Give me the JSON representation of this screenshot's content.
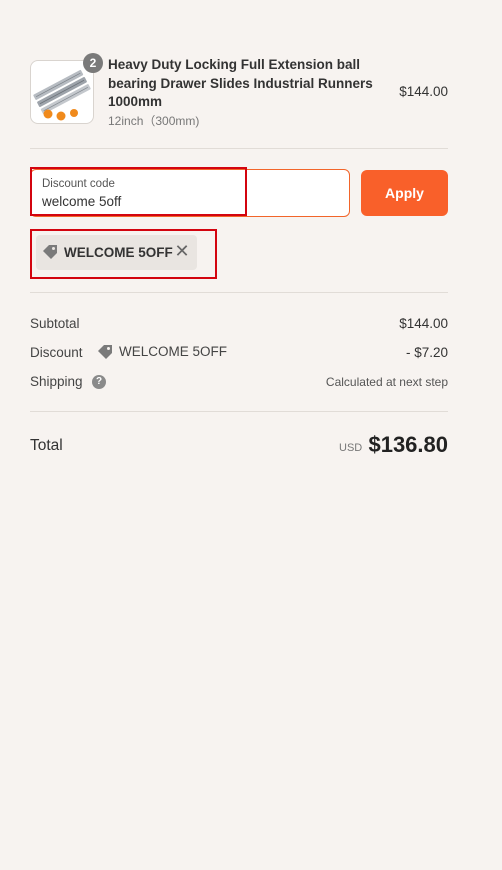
{
  "product": {
    "quantity": "2",
    "title": "Heavy Duty Locking Full Extension ball bearing Drawer Slides Industrial Runners 1000mm",
    "variant": "12inch（300mm)",
    "price": "$144.00",
    "image_icon": "drawer-slides-image"
  },
  "discount": {
    "label": "Discount code",
    "value": "welcome 5off",
    "apply_label": "Apply",
    "applied_code": "WELCOME 5OFF",
    "remove_icon": "close-icon"
  },
  "totals": {
    "subtotal_label": "Subtotal",
    "subtotal_value": "$144.00",
    "discount_label": "Discount",
    "discount_code": "WELCOME 5OFF",
    "discount_value": "- $7.20",
    "shipping_label": "Shipping",
    "shipping_help_icon": "question-icon",
    "shipping_value": "Calculated at next step",
    "total_label": "Total",
    "currency": "USD",
    "total_value": "$136.80"
  },
  "colors": {
    "accent": "#f9602a",
    "highlight": "#d3040f",
    "background": "#f7f3f0"
  }
}
